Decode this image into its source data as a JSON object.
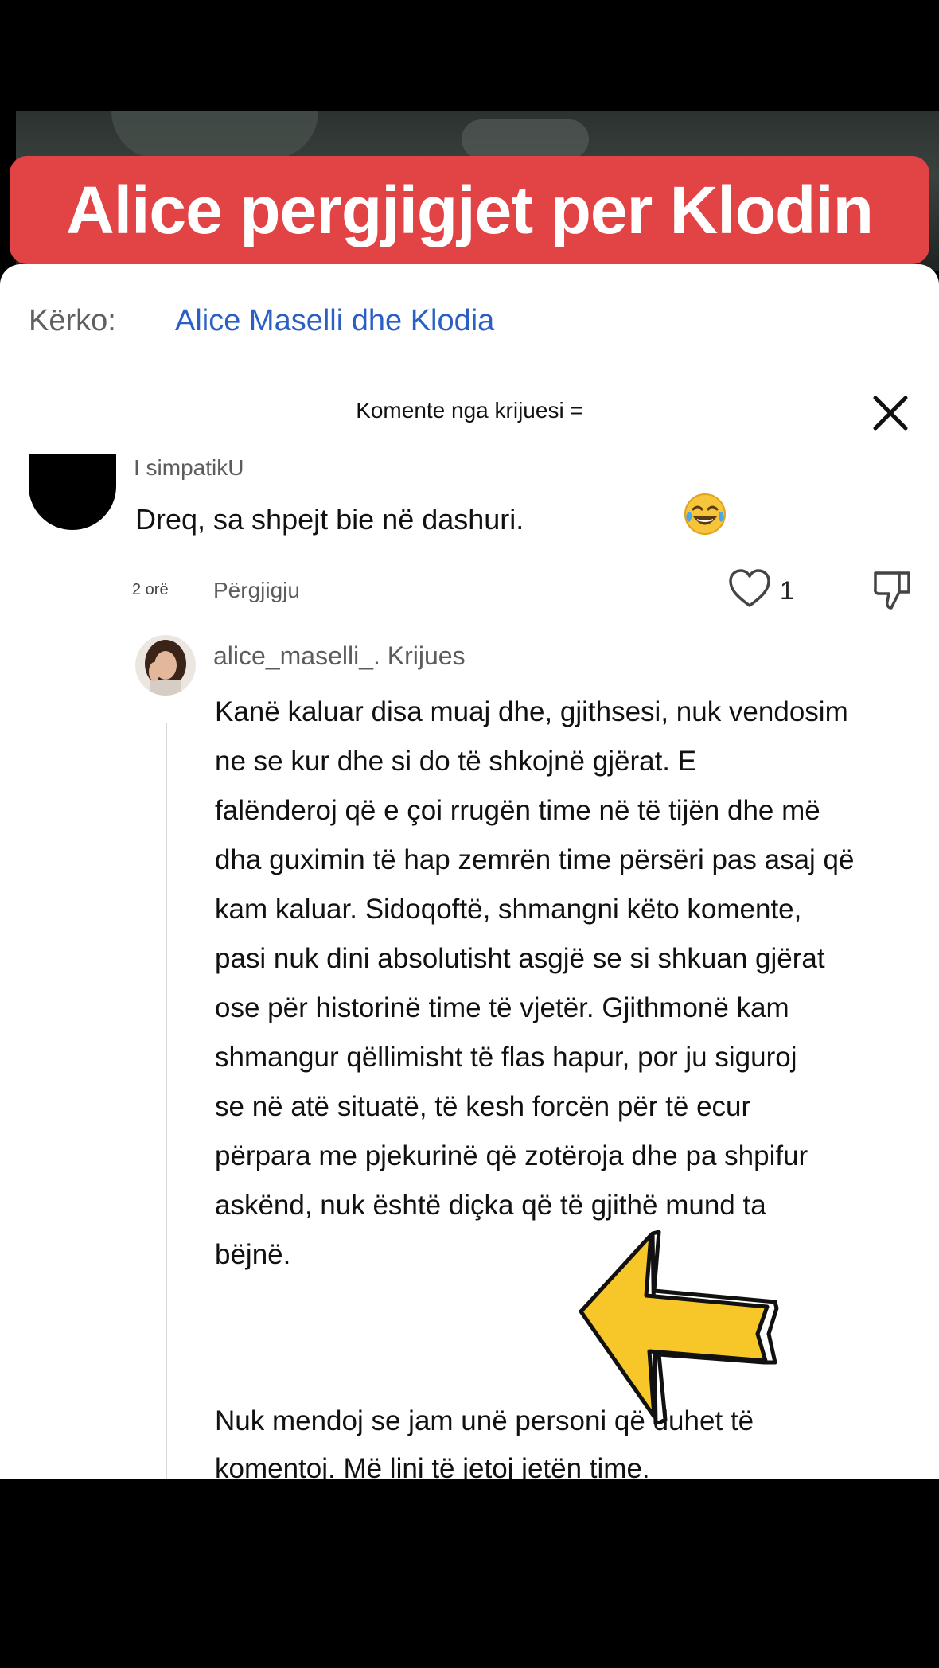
{
  "title_banner": "Alice pergjigjet per Klodin",
  "search": {
    "label": "Kërko:",
    "value": "Alice Maselli dhe Klodia"
  },
  "comments_header": "Komente nga krijuesi =",
  "comment": {
    "username": "I simpatikU",
    "text": "Dreq, sa shpejt bie në dashuri.",
    "emoji_icon": "face-with-tears-of-joy-icon",
    "time_ago": "2 orë",
    "reply_label": "Përgjigju",
    "likes": "1"
  },
  "reply": {
    "username": "alice_maselli_. Krijues",
    "paragraph1": "Kanë kaluar disa muaj dhe, gjithsesi, nuk vendosim\nne se kur dhe si do të shkojnë gjërat. E\nfalënderoj që e çoi rrugën time në të tijën dhe më\ndha guximin të hap zemrën time përsëri pas asaj që\nkam kaluar. Sidoqoftë, shmangni këto komente,\npasi nuk dini absolutisht asgjë se si shkuan gjërat\nose për historinë time të vjetër. Gjithmonë kam\nshmangur qëllimisht të flas hapur, por ju siguroj\nse në atë situatë, të kesh forcën për të ecur\npërpara me pjekurinë që zotëroja dhe pa shpifur\naskënd, nuk është diçka që të gjithë mund ta\nbëjnë.",
    "paragraph2": "Nuk mendoj se jam unë personi që duhet të\nkomentoj. Më lini të jetoj jetën time."
  },
  "colors": {
    "banner": "#e24446",
    "link": "#2b5fc4",
    "arrow": "#f7c628"
  }
}
